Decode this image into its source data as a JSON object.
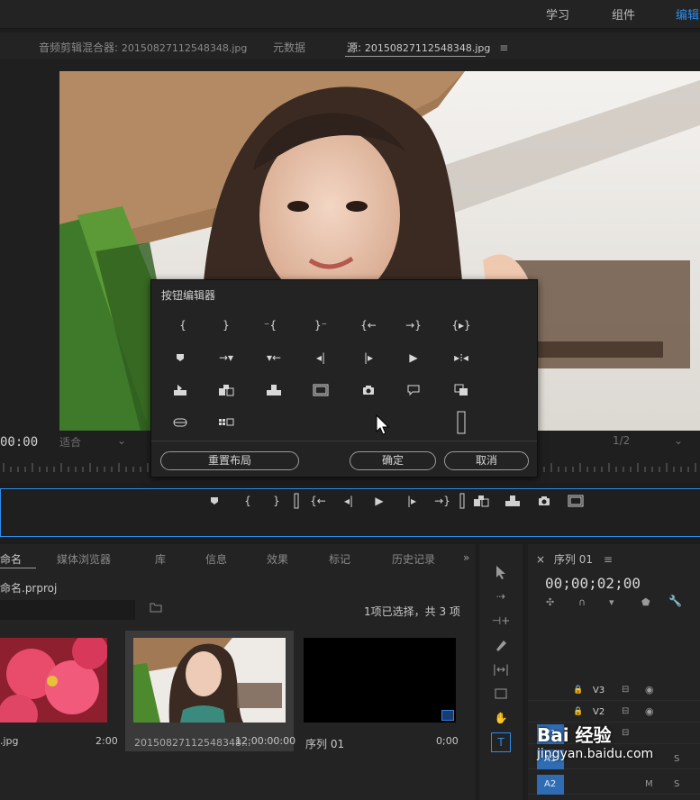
{
  "workspaces": [
    "学习",
    "组件",
    "编辑"
  ],
  "source_panel": {
    "tabs": [
      {
        "label": "音频剪辑混合器:",
        "file": "20150827112548348.jpg"
      },
      {
        "label": "元数据"
      },
      {
        "label": "源:",
        "file": "20150827112548348.jpg"
      }
    ],
    "timecode": "00:00",
    "fit": "适合",
    "resolution": "1/2"
  },
  "dialog": {
    "title": "按钮编辑器",
    "reset_label": "重置布局",
    "ok_label": "确定",
    "cancel_label": "取消"
  },
  "project": {
    "tabs": [
      "命名",
      "媒体浏览器",
      "库",
      "信息",
      "效果",
      "标记",
      "历史记录"
    ],
    "name": "命名.prproj",
    "selection_info": "1项已选择，共 3 项",
    "items": [
      {
        "name": ".jpg",
        "duration": "2:00"
      },
      {
        "name": "20150827112548348...",
        "duration": "12:00:00:00"
      },
      {
        "name": "序列 01",
        "duration": "0;00"
      }
    ]
  },
  "timeline": {
    "tab": "序列 01",
    "timecode": "00;00;02;00",
    "tracks": [
      {
        "name": "V3"
      },
      {
        "name": "V2"
      },
      {
        "name": "V1",
        "selected": true
      },
      {
        "name": "A1",
        "selected": true
      },
      {
        "name": "A2",
        "selected": true
      }
    ],
    "audio_letters": [
      "M",
      "S"
    ]
  },
  "watermark": {
    "brand": "Bai 经验",
    "url": "jingyan.baidu.com"
  },
  "colors": {
    "accent": "#2d8ceb",
    "panel": "#232323"
  }
}
